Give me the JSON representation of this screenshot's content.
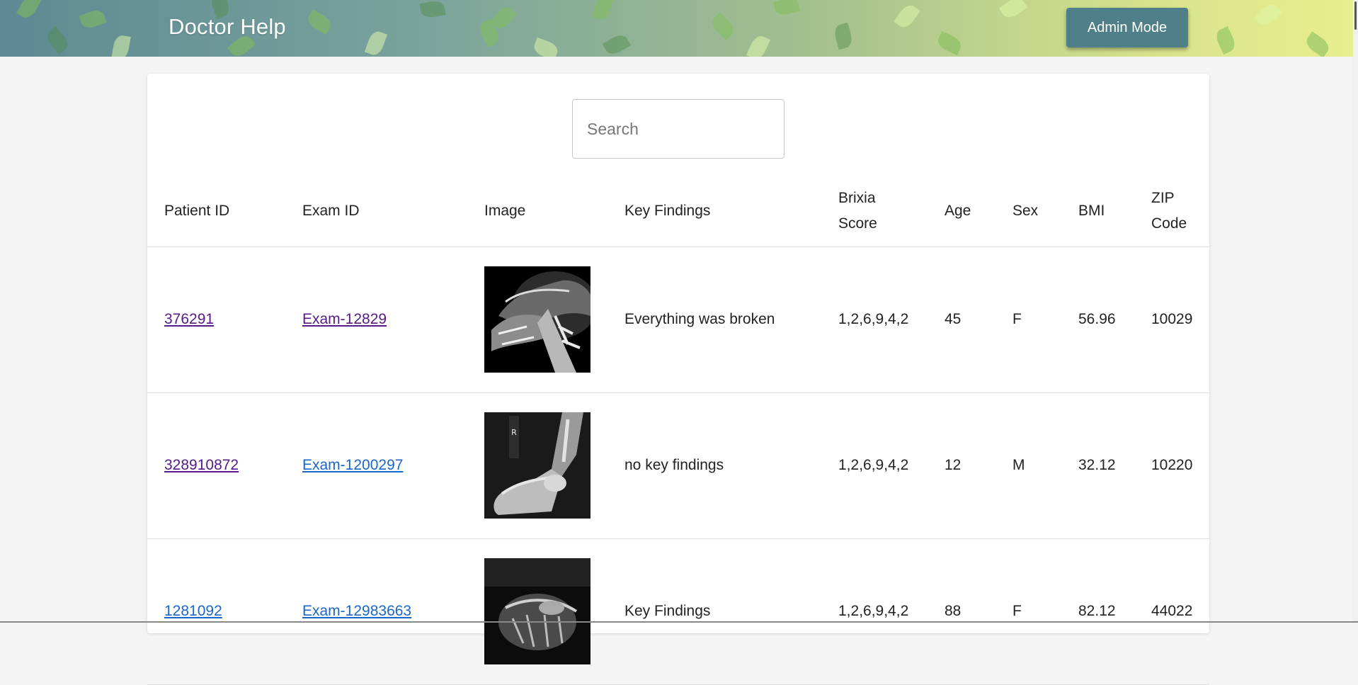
{
  "header": {
    "app_title": "Doctor Help",
    "admin_button": "Admin Mode"
  },
  "search": {
    "placeholder": "Search",
    "value": ""
  },
  "table": {
    "headers": {
      "patient_id": "Patient ID",
      "exam_id": "Exam ID",
      "image": "Image",
      "key_findings": "Key Findings",
      "brixia_line1": "Brixia",
      "brixia_line2": "Score",
      "age": "Age",
      "sex": "Sex",
      "bmi": "BMI",
      "zip_line1": "ZIP",
      "zip_line2": "Code"
    },
    "rows": [
      {
        "patient_id": "376291",
        "exam_id": "Exam-12829",
        "image": "neck-xray",
        "key_findings": "Everything was broken",
        "brixia": "1,2,6,9,4,2",
        "age": "45",
        "sex": "F",
        "bmi": "56.96",
        "zip": "10029"
      },
      {
        "patient_id": "328910872",
        "exam_id": "Exam-1200297",
        "image": "foot-xray",
        "key_findings": "no key findings",
        "brixia": "1,2,6,9,4,2",
        "age": "12",
        "sex": "M",
        "bmi": "32.12",
        "zip": "10220"
      },
      {
        "patient_id": "1281092",
        "exam_id": "Exam-12983663",
        "image": "chest-xray",
        "key_findings": "Key Findings",
        "brixia": "1,2,6,9,4,2",
        "age": "88",
        "sex": "F",
        "bmi": "82.12",
        "zip": "44022"
      }
    ]
  },
  "colors": {
    "header_button": "#4f7f88",
    "visited_link": "#551a8b",
    "link": "#1a66c9"
  }
}
